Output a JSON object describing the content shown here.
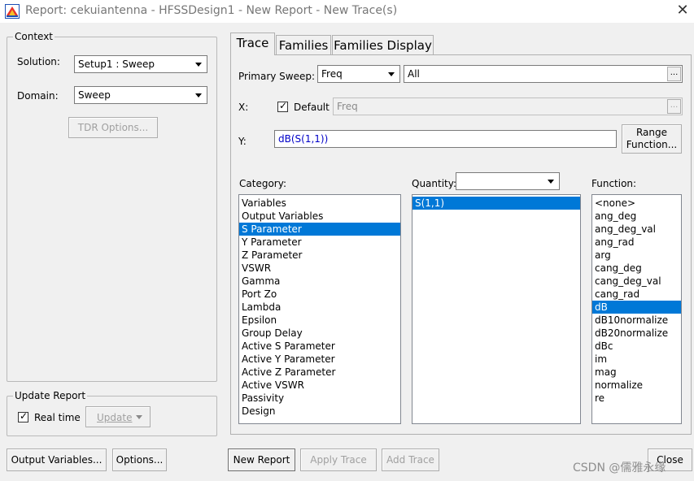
{
  "window": {
    "title": "Report: cekuiantenna - HFSSDesign1 - New Report - New Trace(s)",
    "close_glyph": "✕"
  },
  "context": {
    "legend": "Context",
    "solution_label": "Solution:",
    "solution_value": "Setup1 : Sweep",
    "domain_label": "Domain:",
    "domain_value": "Sweep",
    "tdr_button": "TDR Options..."
  },
  "update_report": {
    "legend": "Update Report",
    "realtime_label": "Real time",
    "realtime_checked": true,
    "update_button": "Update"
  },
  "tabs": [
    {
      "label": "Trace",
      "active": true
    },
    {
      "label": "Families",
      "active": false
    },
    {
      "label": "Families Display",
      "active": false
    }
  ],
  "trace": {
    "primary_sweep_label": "Primary Sweep:",
    "primary_sweep_value": "Freq",
    "primary_sweep_range": "All",
    "x_label": "X:",
    "default_label": "Default",
    "default_checked": true,
    "x_value": "Freq",
    "y_label": "Y:",
    "y_value": "dB(S(1,1))",
    "range_function_line1": "Range",
    "range_function_line2": "Function...",
    "ellipsis": "..."
  },
  "category": {
    "label": "Category:",
    "selected": "S Parameter",
    "items": [
      "Variables",
      "Output Variables",
      "S Parameter",
      "Y Parameter",
      "Z Parameter",
      "VSWR",
      "Gamma",
      "Port Zo",
      "Lambda",
      "Epsilon",
      "Group Delay",
      "Active S Parameter",
      "Active Y Parameter",
      "Active Z Parameter",
      "Active VSWR",
      "Passivity",
      "Design"
    ]
  },
  "quantity": {
    "label": "Quantity:",
    "filter_value": "",
    "selected": "S(1,1)",
    "items": [
      "S(1,1)"
    ]
  },
  "function": {
    "label": "Function:",
    "selected": "dB",
    "items": [
      "<none>",
      "ang_deg",
      "ang_deg_val",
      "ang_rad",
      "arg",
      "cang_deg",
      "cang_deg_val",
      "cang_rad",
      "dB",
      "dB10normalize",
      "dB20normalize",
      "dBc",
      "im",
      "mag",
      "normalize",
      "re"
    ]
  },
  "bottom_buttons": {
    "output_variables": "Output Variables...",
    "options": "Options...",
    "new_report": "New Report",
    "apply_trace": "Apply Trace",
    "add_trace": "Add Trace",
    "close": "Close"
  },
  "watermark": "CSDN @儒雅永缘",
  "colors": {
    "selection": "#0078d7",
    "window_bg": "#f0f0f0",
    "y_expression_text": "#0000c8"
  }
}
